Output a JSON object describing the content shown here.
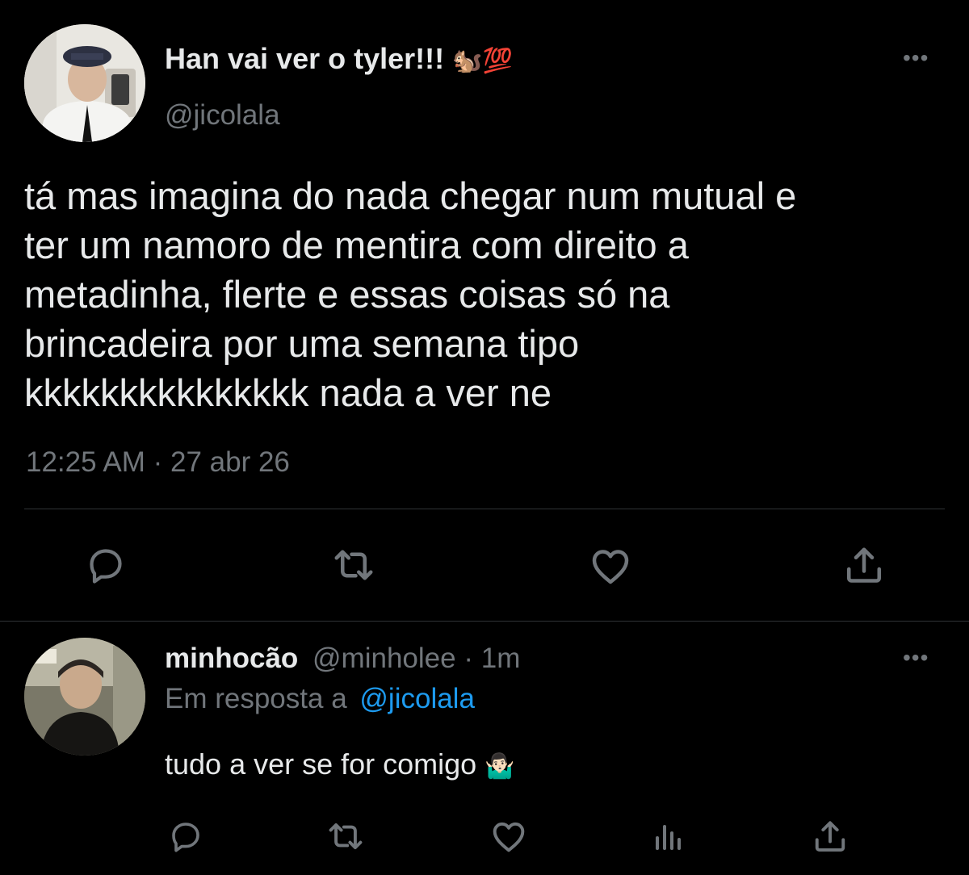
{
  "main_tweet": {
    "author_name": "Han vai ver o tyler!!!",
    "author_emojis": "🐿️💯",
    "author_handle": "@jicolala",
    "text_lines": [
      "tá mas imagina do nada chegar num mutual e",
      "ter um namoro de mentira com direito a",
      "metadinha, flerte e essas coisas só na",
      "brincadeira por uma semana tipo",
      "kkkkkkkkkkkkkkk nada a ver ne"
    ],
    "time": "12:25 AM · 27 abr 26",
    "more": "•••"
  },
  "reply": {
    "author_name": "minhocão",
    "author_handle": "@minholee",
    "age": "· 1m",
    "reply_prefix": "Em resposta a",
    "reply_to": "@jicolala",
    "text": "tudo a ver se for comigo",
    "emoji": "🤷🏻‍♂️",
    "more": "•••"
  },
  "icons": {
    "reply": "reply-icon",
    "retweet": "retweet-icon",
    "like": "like-icon",
    "share": "share-icon",
    "analytics": "analytics-icon"
  },
  "colors": {
    "background": "#000000",
    "text": "#e7e9ea",
    "muted": "#71767b",
    "link": "#1d9bf0",
    "divider": "#2f3336"
  }
}
